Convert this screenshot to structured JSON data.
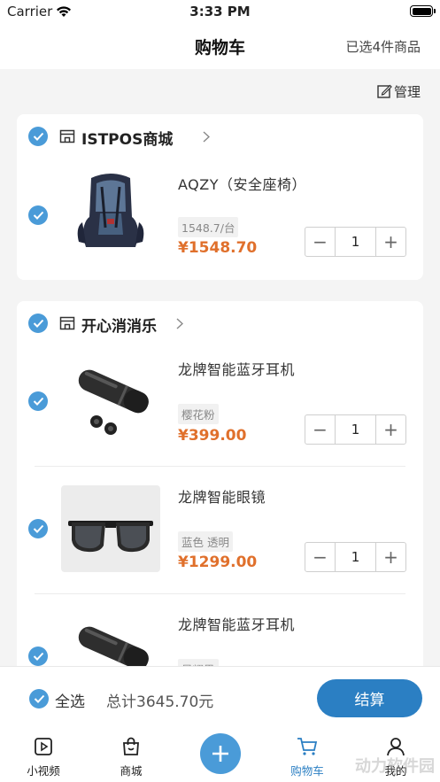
{
  "status_bar": {
    "carrier": "Carrier",
    "time": "3:33 PM"
  },
  "nav": {
    "title": "购物车",
    "selected_count": "已选4件商品"
  },
  "manage_label": "管理",
  "stores": [
    {
      "name": "ISTPOS商城",
      "items": [
        {
          "name": "AQZY（安全座椅）",
          "spec": "1548.7/台",
          "price": "¥1548.70",
          "qty": "1"
        }
      ]
    },
    {
      "name": "开心消消乐",
      "items": [
        {
          "name": "龙牌智能蓝牙耳机",
          "spec": "樱花粉",
          "price": "¥399.00",
          "qty": "1"
        },
        {
          "name": "龙牌智能眼镜",
          "spec": "蓝色 透明",
          "price": "¥1299.00",
          "qty": "1"
        },
        {
          "name": "龙牌智能蓝牙耳机",
          "spec": "星耀黑",
          "price": "",
          "qty": ""
        }
      ]
    }
  ],
  "stepper": {
    "minus": "−",
    "plus": "+"
  },
  "checkout": {
    "select_all": "全选",
    "total": "总计3645.70元",
    "pay_label": "结算"
  },
  "tabbar": [
    {
      "label": "小视频",
      "icon": "play-icon"
    },
    {
      "label": "商城",
      "icon": "bag-icon"
    },
    {
      "label": "",
      "icon": "plus-icon"
    },
    {
      "label": "购物车",
      "icon": "cart-icon"
    },
    {
      "label": "我的",
      "icon": "user-icon"
    }
  ],
  "watermark": "动力软件园",
  "colors": {
    "accent": "#4a9bd8",
    "pay_button": "#2b7fc3",
    "price": "#e0702c",
    "background": "#f4f4f4"
  }
}
